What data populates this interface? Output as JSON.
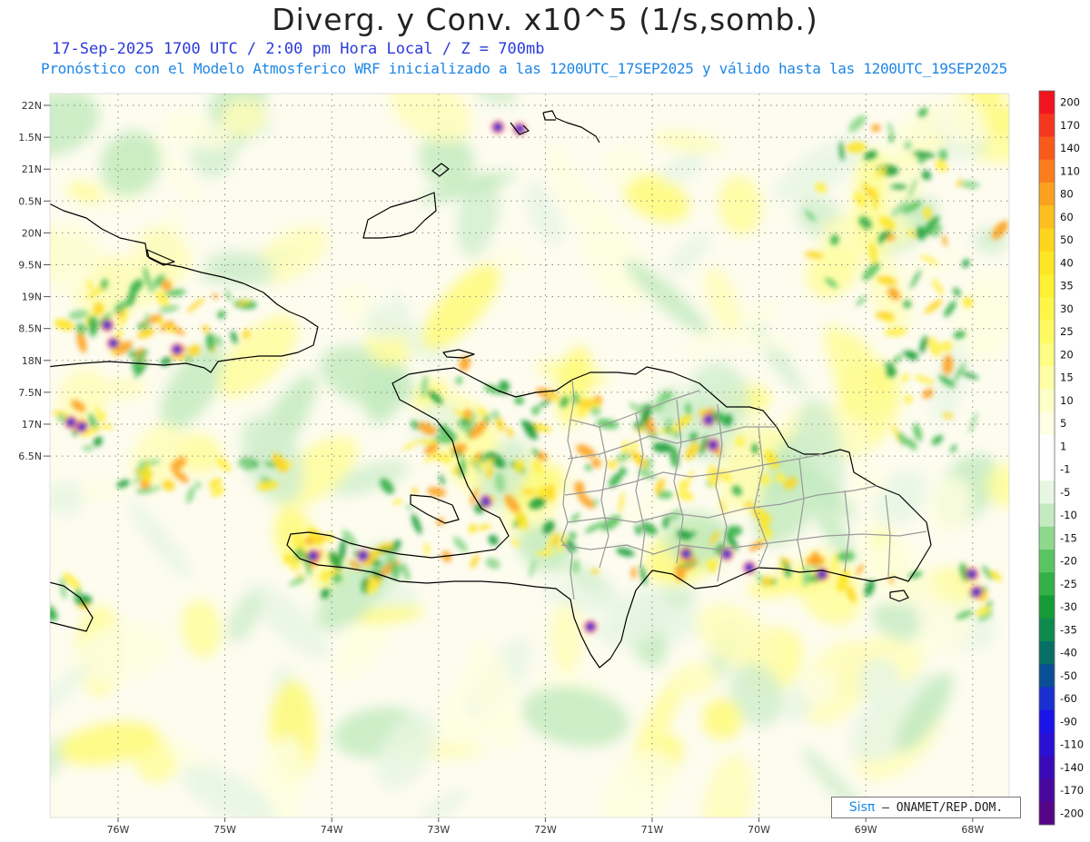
{
  "header": {
    "title": "Diverg. y Conv. x10^5 (1/s,somb.)",
    "line1": "17-Sep-2025  1700 UTC / 2:00 pm Hora Local / Z = 700mb",
    "line2": "Pronóstico con el Modelo Atmosferico WRF inicializado a las 1200UTC_17SEP2025 y válido hasta las  1200UTC_19SEP2025"
  },
  "axes": {
    "lat_labels": [
      "22N",
      "1.5N",
      "21N",
      "0.5N",
      "20N",
      "9.5N",
      "19N",
      "8.5N",
      "18N",
      "7.5N",
      "17N",
      "6.5N"
    ],
    "lon_labels": [
      "76W",
      "75W",
      "74W",
      "73W",
      "72W",
      "71W",
      "70W",
      "69W",
      "68W"
    ],
    "lat_values": [
      22,
      21.5,
      21,
      20.5,
      20,
      19.5,
      19,
      18.5,
      18,
      17.5,
      17,
      16.5
    ],
    "lon_values": [
      -76,
      -75,
      -74,
      -73,
      -72,
      -71,
      -70,
      -69,
      -68
    ]
  },
  "legend": {
    "labels": [
      "200",
      "170",
      "140",
      "110",
      "80",
      "60",
      "50",
      "40",
      "35",
      "30",
      "25",
      "20",
      "15",
      "10",
      "5",
      "1",
      "-1",
      "-5",
      "-10",
      "-15",
      "-20",
      "-25",
      "-30",
      "-35",
      "-40",
      "-50",
      "-60",
      "-90",
      "-110",
      "-140",
      "-170",
      "-200"
    ],
    "colors": [
      "#f0141e",
      "#f5361e",
      "#f85a1c",
      "#fb7d1c",
      "#fca21e",
      "#fdc020",
      "#fdd51c",
      "#fde624",
      "#fef032",
      "#fef548",
      "#fefa64",
      "#fefd84",
      "#fefea6",
      "#fefec8",
      "#fefee4",
      "#ffffff",
      "#ffffff",
      "#e8f6e4",
      "#c4ebc0",
      "#8fd88e",
      "#5bc462",
      "#34b048",
      "#169c36",
      "#0e8a4e",
      "#077065",
      "#0a4e95",
      "#1a2fd0",
      "#1a14e6",
      "#2a0fd4",
      "#3a0ab8",
      "#48079e",
      "#560488"
    ]
  },
  "credit": {
    "brand": "Sisπ",
    "org": "– ONAMET/REP.DOM."
  },
  "colors": {
    "title": "#222222",
    "line1": "#2a3ad8",
    "line2": "#1d86e6",
    "coast": "#000000",
    "provinces": "#9a9a9a"
  }
}
